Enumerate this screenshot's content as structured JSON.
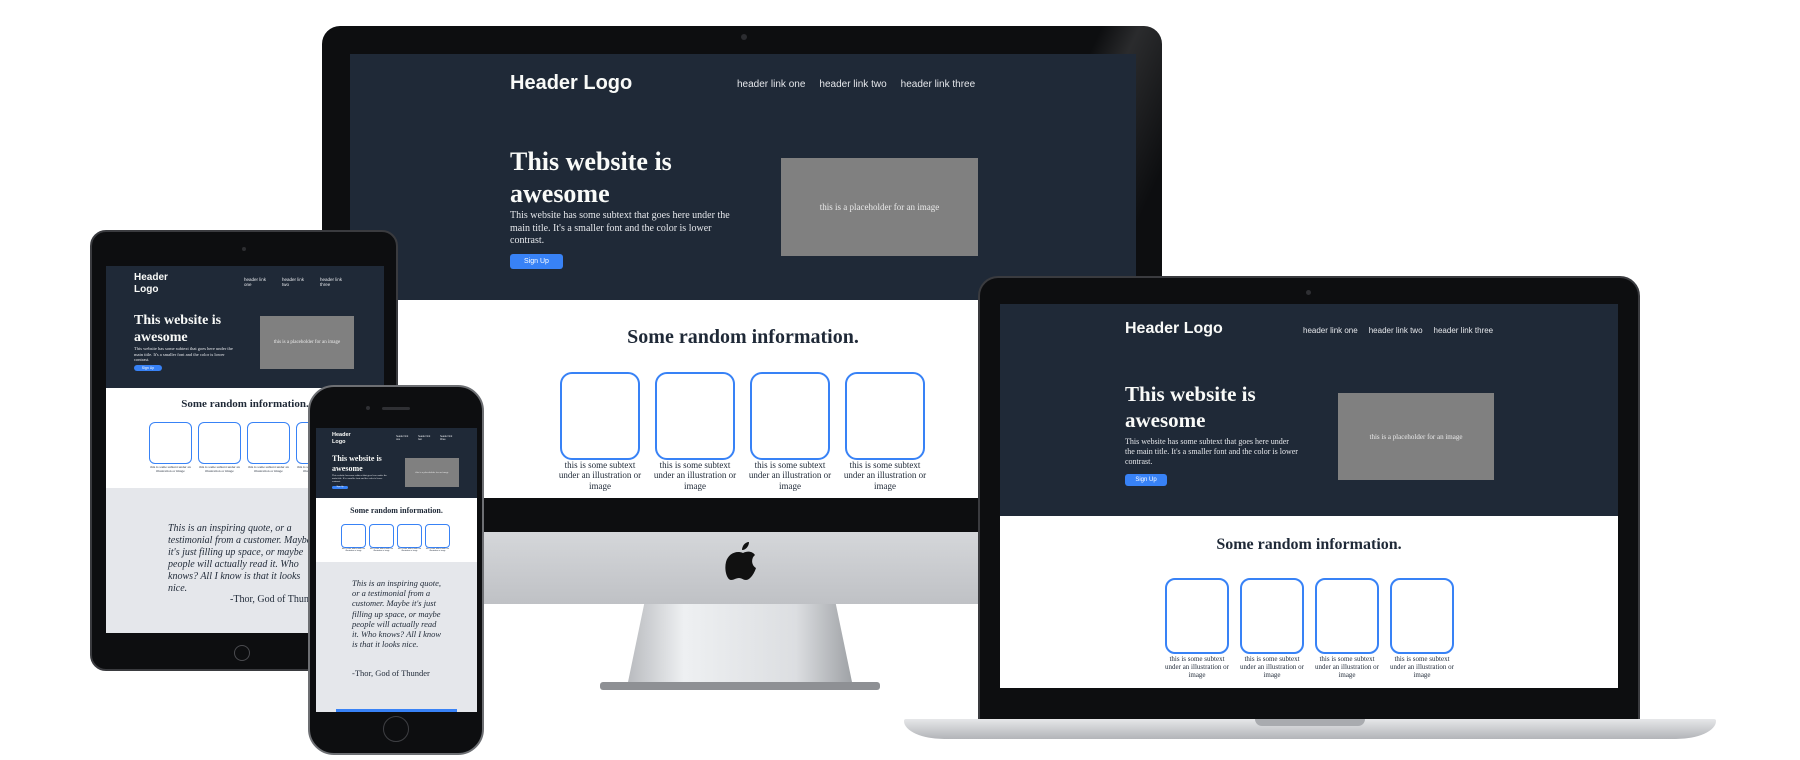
{
  "site": {
    "logo": "Header Logo",
    "nav": [
      "header link one",
      "header link two",
      "header link three"
    ],
    "hero_title": "This website is awesome",
    "hero_subtext": "This website has some subtext that goes here under the main title. It's a smaller font and the color is lower contrast.",
    "signup_label": "Sign Up",
    "image_placeholder": "this is a placeholder for an image",
    "info_title": "Some random information.",
    "card_caption": "this is some subtext under an illustration or image",
    "quote": "This is an inspiring quote, or a testimonial from a customer. Maybe it's just filling up space, or maybe people will actually read it. Who knows? All I know is that it looks nice.",
    "quote_author": "-Thor, God of Thunder"
  },
  "colors": {
    "hero_bg": "#1f2937",
    "accent": "#3882f6",
    "placeholder": "#808080",
    "quote_bg": "#e5e7eb",
    "device_frame": "#0d0e10"
  },
  "devices": [
    "desktop-monitor",
    "tablet",
    "smartphone",
    "laptop"
  ],
  "icons": [
    "apple-logo-icon",
    "camera-icon",
    "home-button-icon",
    "speaker-icon"
  ]
}
